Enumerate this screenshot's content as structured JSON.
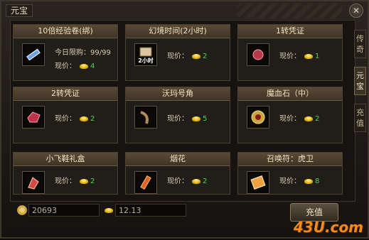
{
  "window": {
    "title": "元宝",
    "close_glyph": "✕"
  },
  "side_tabs": [
    {
      "label": "传\n奇",
      "active": false
    },
    {
      "label": "元\n宝",
      "active": true
    },
    {
      "label": "充\n值",
      "active": false
    }
  ],
  "price_label": "现价：",
  "items": [
    {
      "name": "10倍经验卷(绑)",
      "price": "4",
      "limit_label": "今日限购：",
      "limit": "99/99",
      "icon": "scroll-icon"
    },
    {
      "name": "幻境时间(2小时)",
      "price": "2",
      "icon_text": "2小时",
      "icon": "time-scroll-icon"
    },
    {
      "name": "1转凭证",
      "price": "1",
      "icon": "red-token-icon"
    },
    {
      "name": "2转凭证",
      "price": "2",
      "icon": "red-crystal-icon"
    },
    {
      "name": "沃玛号角",
      "price": "5",
      "icon": "horn-icon"
    },
    {
      "name": "魔血石（中）",
      "price": "2",
      "icon": "blood-stone-icon"
    },
    {
      "name": "小飞鞋礼盒",
      "price": "2",
      "icon": "flying-shoes-icon"
    },
    {
      "name": "烟花",
      "price": "2",
      "icon": "firework-icon"
    },
    {
      "name": "召唤符：虎卫",
      "price": "8",
      "icon": "summon-scroll-icon"
    }
  ],
  "footer": {
    "gold_coins": "20693",
    "ingots": "12.13",
    "recharge_label": "充值"
  },
  "watermark": "43U.com",
  "colors": {
    "price_green": "#4fd34a",
    "title_gold": "#f0e2c0",
    "watermark_orange": "#f48a1b"
  }
}
